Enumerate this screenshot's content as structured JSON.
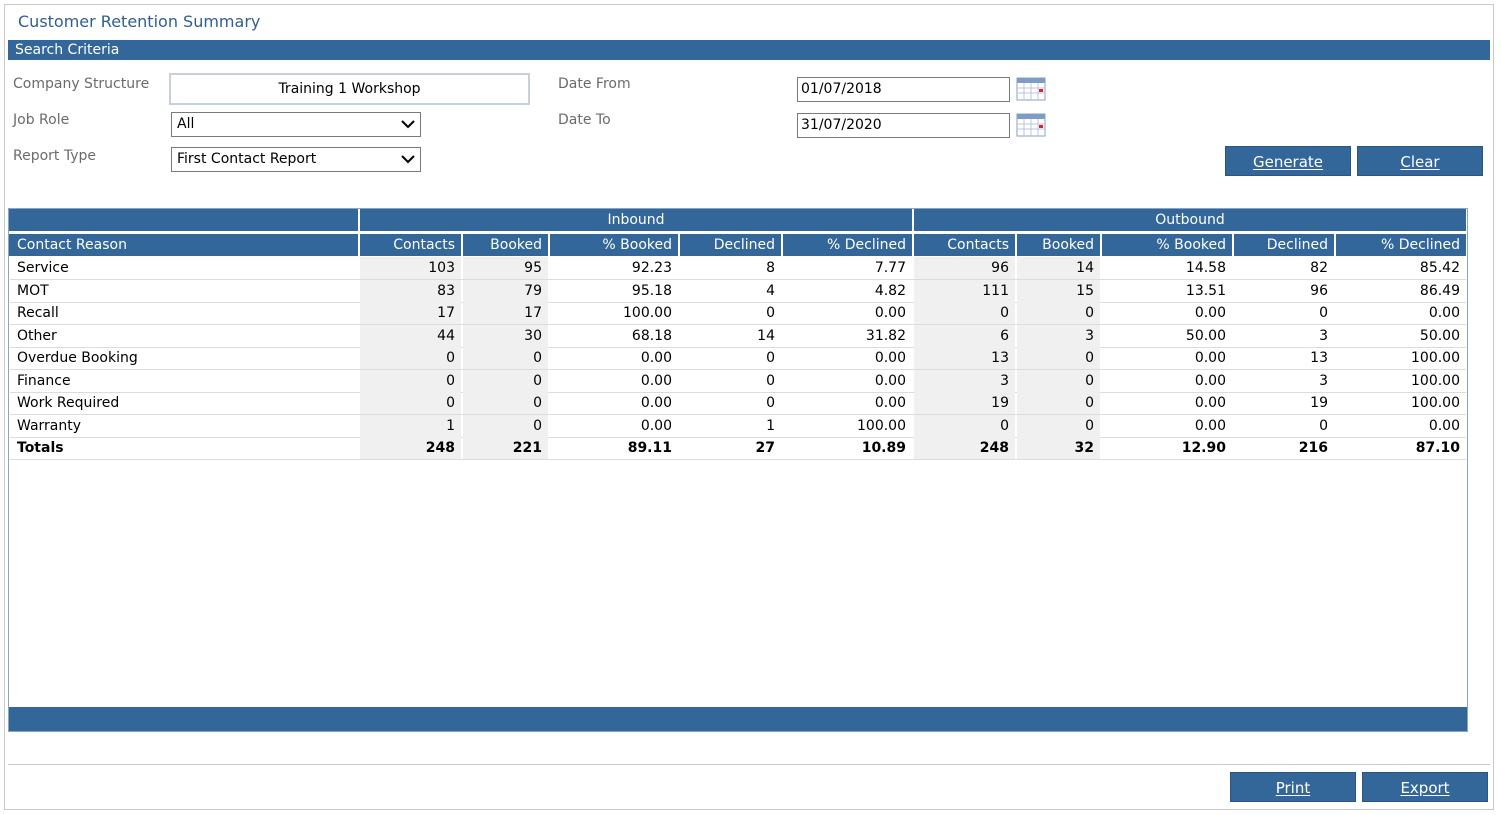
{
  "page_title": "Customer Retention Summary",
  "search_section": "Search Criteria",
  "labels": {
    "company_structure": "Company Structure",
    "job_role": "Job Role",
    "report_type": "Report Type",
    "date_from": "Date From",
    "date_to": "Date To"
  },
  "values": {
    "company_structure": "Training 1 Workshop",
    "job_role": "All",
    "report_type": "First Contact Report",
    "date_from": "01/07/2018",
    "date_to": "31/07/2020"
  },
  "buttons": {
    "generate": "Generate",
    "clear": "Clear",
    "print": "Print",
    "export": "Export"
  },
  "table": {
    "groups": {
      "inbound": "Inbound",
      "outbound": "Outbound"
    },
    "columns": [
      "Contact Reason",
      "Contacts",
      "Booked",
      "% Booked",
      "Declined",
      "% Declined",
      "Contacts",
      "Booked",
      "% Booked",
      "Declined",
      "% Declined"
    ],
    "rows": [
      [
        "Service",
        "103",
        "95",
        "92.23",
        "8",
        "7.77",
        "96",
        "14",
        "14.58",
        "82",
        "85.42"
      ],
      [
        "MOT",
        "83",
        "79",
        "95.18",
        "4",
        "4.82",
        "111",
        "15",
        "13.51",
        "96",
        "86.49"
      ],
      [
        "Recall",
        "17",
        "17",
        "100.00",
        "0",
        "0.00",
        "0",
        "0",
        "0.00",
        "0",
        "0.00"
      ],
      [
        "Other",
        "44",
        "30",
        "68.18",
        "14",
        "31.82",
        "6",
        "3",
        "50.00",
        "3",
        "50.00"
      ],
      [
        "Overdue Booking",
        "0",
        "0",
        "0.00",
        "0",
        "0.00",
        "13",
        "0",
        "0.00",
        "13",
        "100.00"
      ],
      [
        "Finance",
        "0",
        "0",
        "0.00",
        "0",
        "0.00",
        "3",
        "0",
        "0.00",
        "3",
        "100.00"
      ],
      [
        "Work Required",
        "0",
        "0",
        "0.00",
        "0",
        "0.00",
        "19",
        "0",
        "0.00",
        "19",
        "100.00"
      ],
      [
        "Warranty",
        "1",
        "0",
        "0.00",
        "1",
        "100.00",
        "0",
        "0",
        "0.00",
        "0",
        "0.00"
      ]
    ],
    "totals": [
      "Totals",
      "248",
      "221",
      "89.11",
      "27",
      "10.89",
      "248",
      "32",
      "12.90",
      "216",
      "87.10"
    ]
  },
  "icons": {
    "select_arrow": "chevron-down-icon",
    "calendar": "calendar-icon"
  },
  "colors": {
    "accent": "#336699",
    "title": "#2e5f8f",
    "shade": "#f0f0f0"
  }
}
